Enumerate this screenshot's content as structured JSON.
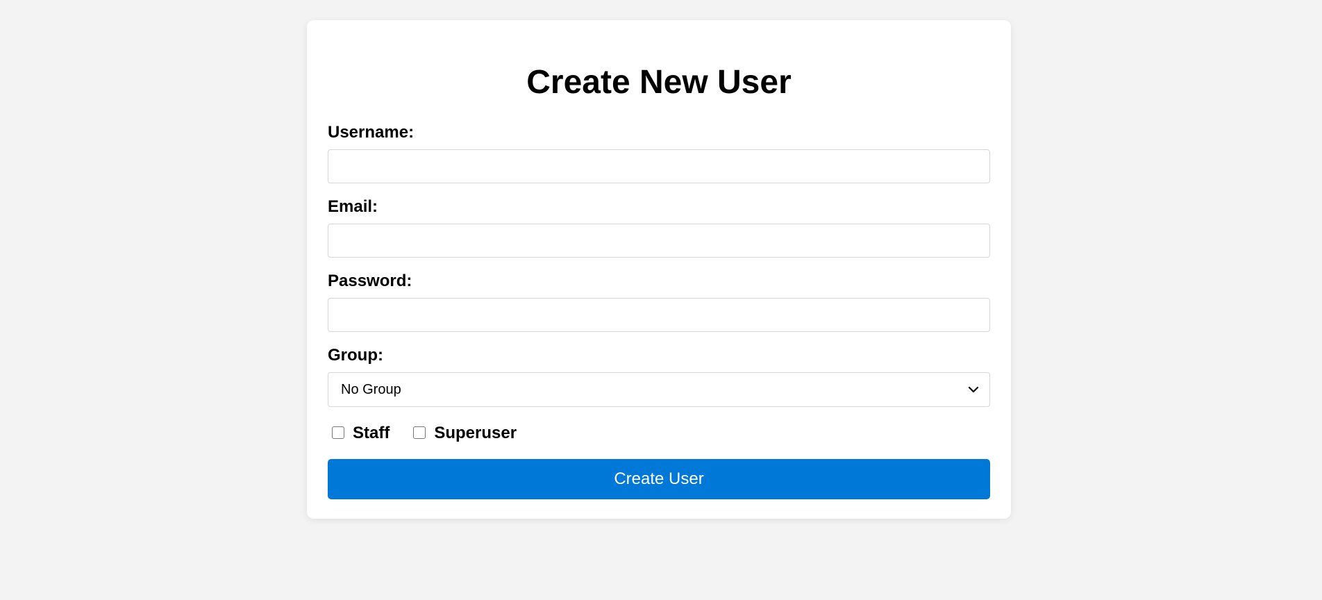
{
  "form": {
    "title": "Create New User",
    "fields": {
      "username": {
        "label": "Username:",
        "value": ""
      },
      "email": {
        "label": "Email:",
        "value": ""
      },
      "password": {
        "label": "Password:",
        "value": ""
      },
      "group": {
        "label": "Group:",
        "selected": "No Group"
      }
    },
    "checkboxes": {
      "staff": {
        "label": "Staff",
        "checked": false
      },
      "superuser": {
        "label": "Superuser",
        "checked": false
      }
    },
    "submit_label": "Create User"
  },
  "colors": {
    "page_bg": "#f3f3f3",
    "card_bg": "#ffffff",
    "accent": "#0078d7"
  },
  "icons": {
    "select_chevron": "chevron-down-icon"
  }
}
